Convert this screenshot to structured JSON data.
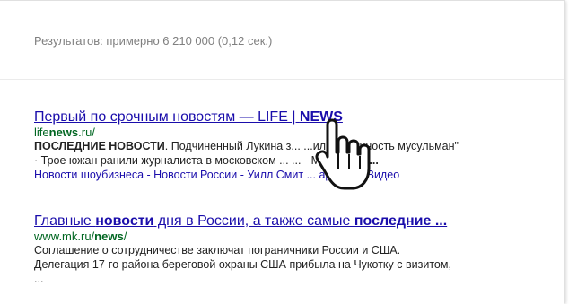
{
  "stats": "Результатов: примерно 6 210 000 (0,12 сек.)",
  "results": [
    {
      "title_pre": "Первый по срочным новостям — LIFE | ",
      "title_bold": "NEWS",
      "url_pre": "life",
      "url_bold": "news",
      "url_post": ".ru/",
      "snippet_bold": "ПОСЛЕДНИЕ НОВОСТИ",
      "snippet_line1": ". Подчиненный Лукина з... ...ил \"Невинность мусульман\"",
      "snippet_line2": "· Трое южан ранили журналиста в московском ... ... - Мосгорсуд",
      "snippet_line2_bold": " ...",
      "sitelinks": [
        "Новости шоубизнеса",
        "Новости России",
        "Уилл Смит ... арил ...",
        "Видео"
      ]
    },
    {
      "title_pre": "Главные ",
      "title_bold1": "новости",
      "title_mid": " дня в России, а также самые ",
      "title_bold2": "последние ...",
      "url_pre": "www.mk.ru/",
      "url_bold": "news",
      "url_post": "/",
      "snippet_line1": "Соглашение о сотрудничестве заключат пограничники России и США.",
      "snippet_line2": "Делегация 17-го района береговой охраны США прибыла на Чукотку с визитом,",
      "snippet_line3": "..."
    }
  ],
  "cursor_icon": "hand-pointer-icon",
  "colors": {
    "link": "#1a0dab",
    "url": "#006621",
    "text": "#222222",
    "stats": "#808080"
  }
}
